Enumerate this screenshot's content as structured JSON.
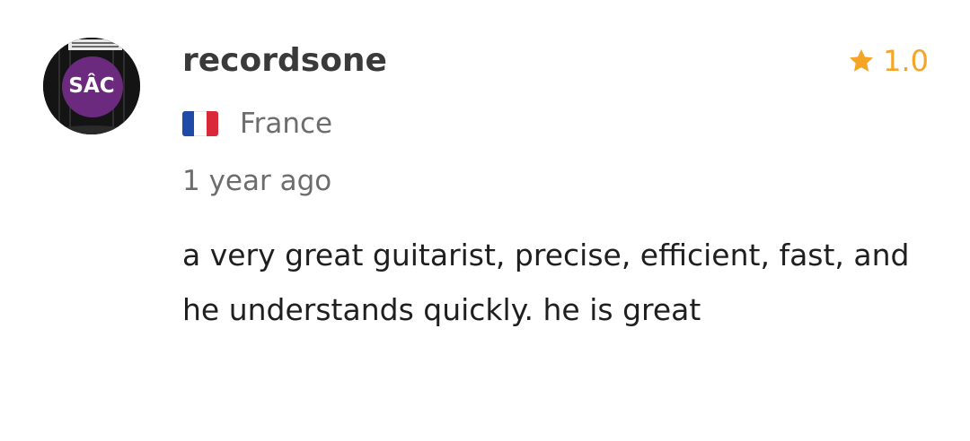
{
  "review": {
    "avatar": {
      "initials": "SÂC",
      "icon": "studio-logo-icon",
      "background_color": "#6b2a7e"
    },
    "username": "recordsone",
    "rating": {
      "icon": "star-icon",
      "value": "1.0",
      "color": "#f4a526"
    },
    "country": {
      "flag_icon": "france-flag-icon",
      "flag_colors": [
        "#1f4aa8",
        "#ffffff",
        "#d8283a"
      ],
      "name": "France"
    },
    "timestamp": "1 year ago",
    "text": "a very great guitarist, precise, efficient, fast, and he understands quickly. he is great"
  }
}
